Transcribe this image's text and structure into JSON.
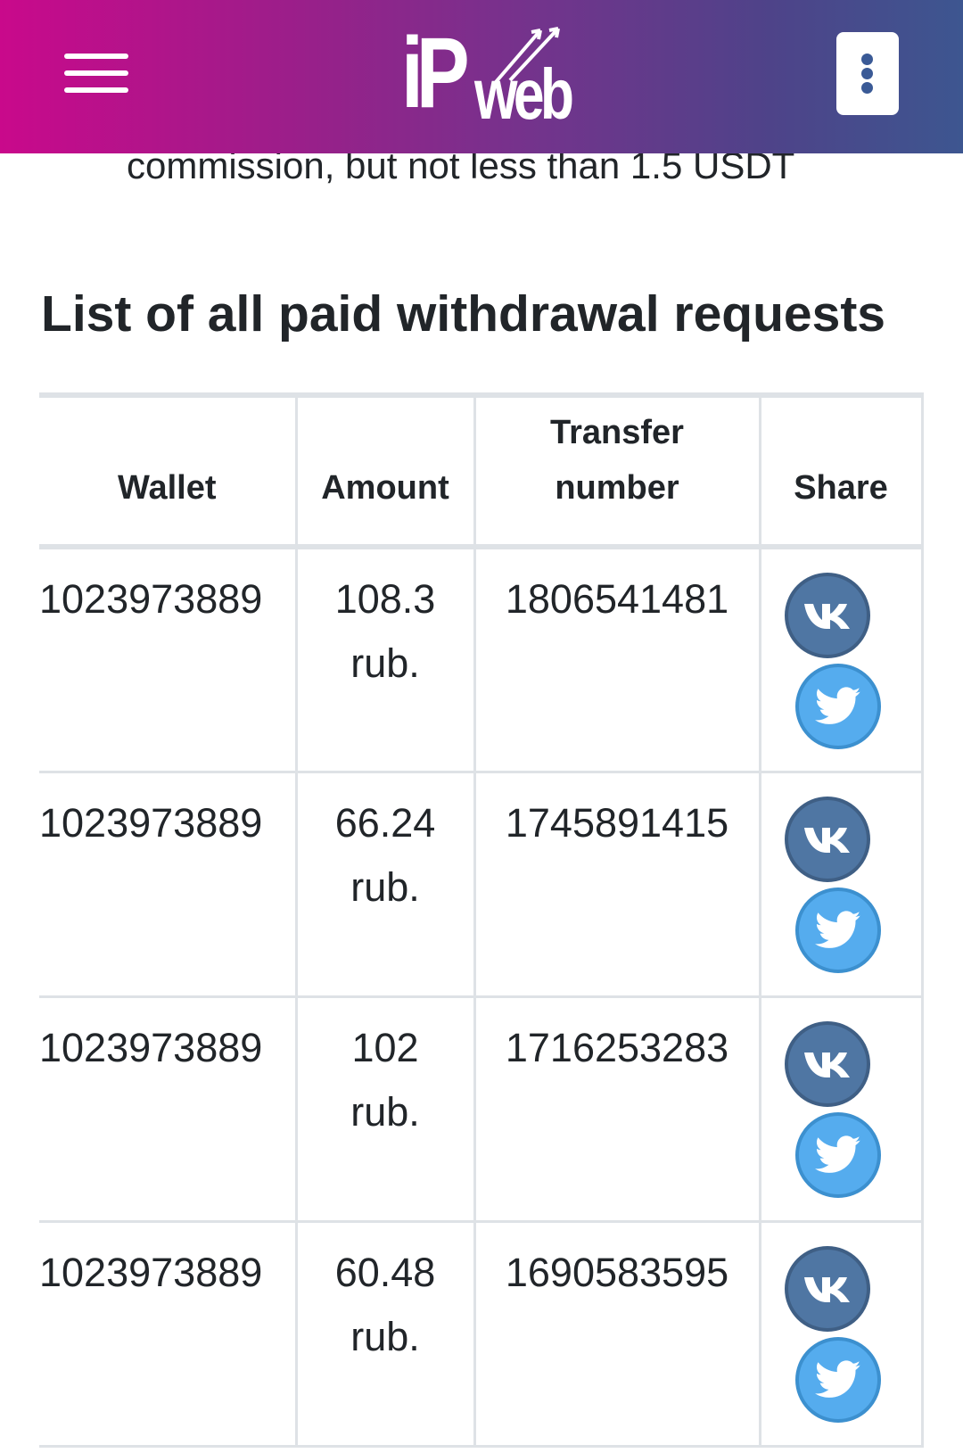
{
  "header": {
    "logo_ip": "iP",
    "logo_web": "web",
    "colors": {
      "gradient_start": "#c9098b",
      "gradient_end": "#3d5690",
      "kebab_dots": "#3a5a96"
    }
  },
  "intro": {
    "commission_text": "commission, but not less than 1.5 USDT"
  },
  "section": {
    "title": "List of all paid withdrawal requests"
  },
  "table": {
    "headers": {
      "wallet": "Wallet",
      "amount": "Amount",
      "transfer": "Transfer number",
      "share": "Share"
    },
    "rows": [
      {
        "wallet": "1023973889",
        "amount": "108.3 rub.",
        "transfer": "1806541481"
      },
      {
        "wallet": "1023973889",
        "amount": "66.24 rub.",
        "transfer": "1745891415"
      },
      {
        "wallet": "1023973889",
        "amount": "102 rub.",
        "transfer": "1716253283"
      },
      {
        "wallet": "1023973889",
        "amount": "60.48 rub.",
        "transfer": "1690583595"
      }
    ],
    "share_icons": [
      "vk-icon",
      "twitter-icon"
    ],
    "colors": {
      "vk": "#4f76a3",
      "twitter": "#55acee"
    }
  }
}
